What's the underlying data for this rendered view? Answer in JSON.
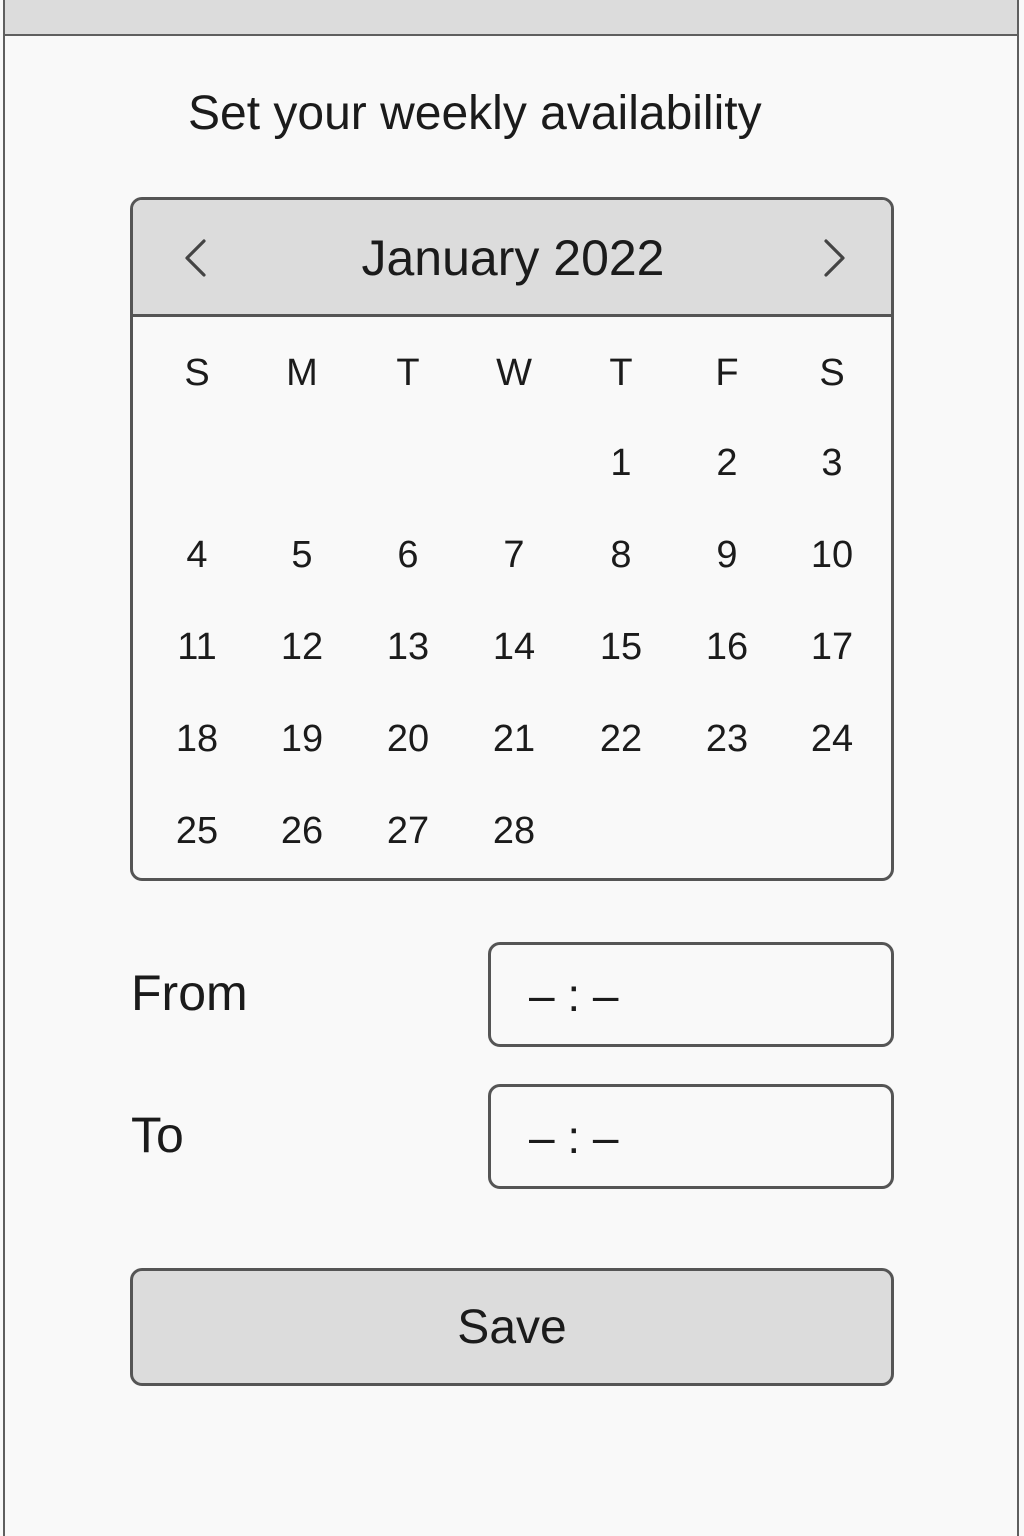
{
  "page": {
    "title": "Set your weekly availability"
  },
  "calendar": {
    "month_label": "January 2022",
    "prev_icon": "chevron-left-icon",
    "next_icon": "chevron-right-icon",
    "weekdays": [
      "S",
      "M",
      "T",
      "W",
      "T",
      "F",
      "S"
    ],
    "weeks": [
      [
        "",
        "",
        "",
        "",
        "1",
        "2",
        "3"
      ],
      [
        "4",
        "5",
        "6",
        "7",
        "8",
        "9",
        "10"
      ],
      [
        "11",
        "12",
        "13",
        "14",
        "15",
        "16",
        "17"
      ],
      [
        "18",
        "19",
        "20",
        "21",
        "22",
        "23",
        "24"
      ],
      [
        "25",
        "26",
        "27",
        "28",
        "",
        "",
        ""
      ]
    ]
  },
  "form": {
    "from_label": "From",
    "from_value": "– : –",
    "to_label": "To",
    "to_value": "– : –"
  },
  "actions": {
    "save_label": "Save"
  },
  "colors": {
    "background": "#f9f9f9",
    "header_fill": "#dcdcdc",
    "border": "#555555",
    "text": "#1b1b1b"
  }
}
